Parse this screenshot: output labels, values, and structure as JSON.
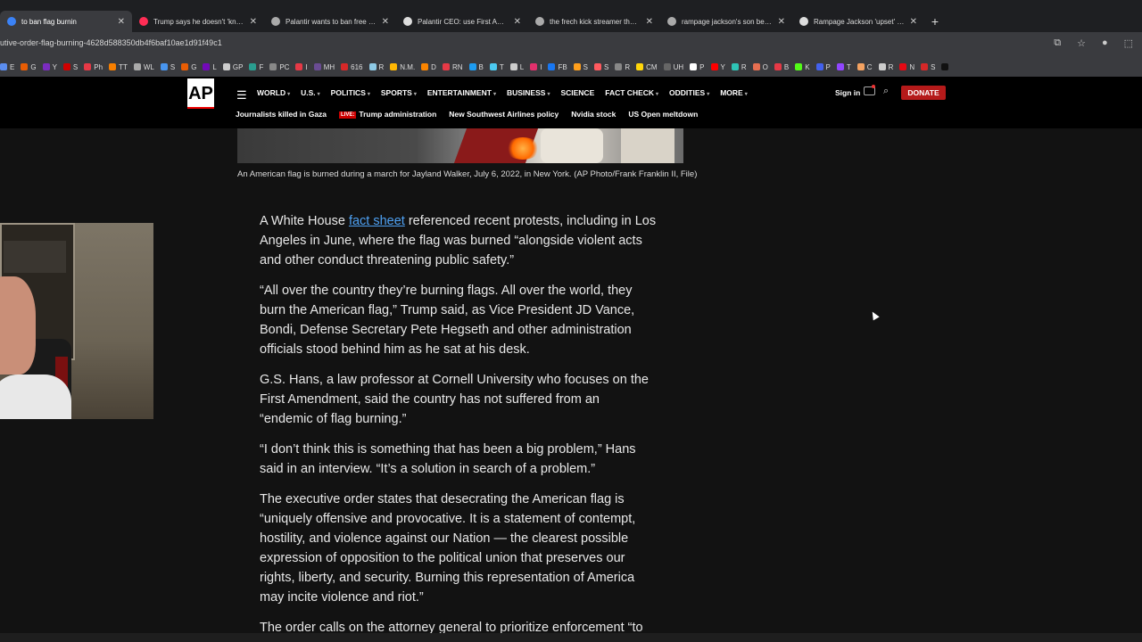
{
  "browser": {
    "tabs": [
      {
        "label": "to ban flag burnin",
        "active": true,
        "icon": "ap-icon",
        "color": "#3b82f6"
      },
      {
        "label": "Trump says he doesn't 'know' if",
        "active": false,
        "icon": "yahoo-icon",
        "color": "#ff2d55"
      },
      {
        "label": "Palantir wants to ban free speech",
        "active": false,
        "icon": "google-icon",
        "color": "#aaaaaa"
      },
      {
        "label": "Palantir CEO: use First Amendm",
        "active": false,
        "icon": "site-icon",
        "color": "#dddddd"
      },
      {
        "label": "the frech kick streamer that mu",
        "active": false,
        "icon": "google-icon",
        "color": "#aaaaaa"
      },
      {
        "label": "rampage jackson's son beat a u",
        "active": false,
        "icon": "google-icon",
        "color": "#aaaaaa"
      },
      {
        "label": "Rampage Jackson 'upset' after",
        "active": false,
        "icon": "site-icon",
        "color": "#dddddd"
      }
    ],
    "new_tab": "+",
    "url": "utive-order-flag-burning-4628d588350db4f6baf10ae1d91f49c1",
    "bookmarks": [
      {
        "label": "E",
        "color": "#5b8def"
      },
      {
        "label": "G",
        "color": "#e85d04"
      },
      {
        "label": "Y",
        "color": "#7b2cbf"
      },
      {
        "label": "S",
        "color": "#d00000"
      },
      {
        "label": "Ph",
        "color": "#e63946"
      },
      {
        "label": "TT",
        "color": "#f77f00"
      },
      {
        "label": "WL",
        "color": "#aaaaaa"
      },
      {
        "label": "S",
        "color": "#4895ef"
      },
      {
        "label": "G",
        "color": "#e85d04"
      },
      {
        "label": "L",
        "color": "#7209b7"
      },
      {
        "label": "GP",
        "color": "#cccccc"
      },
      {
        "label": "F",
        "color": "#2a9d8f"
      },
      {
        "label": "PC",
        "color": "#888888"
      },
      {
        "label": "I",
        "color": "#e63946"
      },
      {
        "label": "MH",
        "color": "#6a4c93"
      },
      {
        "label": "616",
        "color": "#d62828"
      },
      {
        "label": "R",
        "color": "#8ecae6"
      },
      {
        "label": "N.M.",
        "color": "#ffb703"
      },
      {
        "label": "D",
        "color": "#fb8500"
      },
      {
        "label": "RN",
        "color": "#e63946"
      },
      {
        "label": "B",
        "color": "#1d9bf0"
      },
      {
        "label": "T",
        "color": "#4cc9f0"
      },
      {
        "label": "L",
        "color": "#cccccc"
      },
      {
        "label": "I",
        "color": "#e1306c"
      },
      {
        "label": "FB",
        "color": "#1877f2"
      },
      {
        "label": "S",
        "color": "#ff9f1c"
      },
      {
        "label": "S",
        "color": "#ff5a5f"
      },
      {
        "label": "R",
        "color": "#888888"
      },
      {
        "label": "CM",
        "color": "#ffd60a"
      },
      {
        "label": "UH",
        "color": "#666666"
      },
      {
        "label": "P",
        "color": "#ffffff"
      },
      {
        "label": "Y",
        "color": "#ff0000"
      },
      {
        "label": "R",
        "color": "#2ec4b6"
      },
      {
        "label": "O",
        "color": "#e76f51"
      },
      {
        "label": "B",
        "color": "#e63946"
      },
      {
        "label": "K",
        "color": "#53fc18"
      },
      {
        "label": "P",
        "color": "#4361ee"
      },
      {
        "label": "T",
        "color": "#9146ff"
      },
      {
        "label": "C",
        "color": "#f4a261"
      },
      {
        "label": "R",
        "color": "#cccccc"
      },
      {
        "label": "N",
        "color": "#e50914"
      },
      {
        "label": "S",
        "color": "#d62828"
      },
      {
        "label": "",
        "color": "#111111"
      }
    ]
  },
  "ap": {
    "logo": "AP",
    "nav": [
      {
        "label": "WORLD",
        "caret": true
      },
      {
        "label": "U.S.",
        "caret": true
      },
      {
        "label": "POLITICS",
        "caret": true
      },
      {
        "label": "SPORTS",
        "caret": true
      },
      {
        "label": "ENTERTAINMENT",
        "caret": true
      },
      {
        "label": "BUSINESS",
        "caret": true
      },
      {
        "label": "SCIENCE",
        "caret": false
      },
      {
        "label": "FACT CHECK",
        "caret": true
      },
      {
        "label": "ODDITIES",
        "caret": true
      },
      {
        "label": "MORE",
        "caret": true
      }
    ],
    "signin": "Sign in",
    "donate": "DONATE",
    "live_badge": "LIVE:",
    "trending": [
      {
        "label": "Journalists killed in Gaza",
        "live": false
      },
      {
        "label": "Trump administration",
        "live": true
      },
      {
        "label": "New Southwest Airlines policy",
        "live": false
      },
      {
        "label": "Nvidia stock",
        "live": false
      },
      {
        "label": "US Open meltdown",
        "live": false
      }
    ]
  },
  "article": {
    "caption": "An American flag is burned during a march for Jayland Walker, July 6, 2022, in New York. (AP Photo/Frank Franklin II, File)",
    "p1_before": "A White House ",
    "p1_link": "fact sheet",
    "p1_after": " referenced recent protests, including in Los\nAngeles in June, where the flag was burned “alongside violent acts\nand other conduct threatening public safety.”",
    "p2": "“All over the country they’re burning flags. All over the world, they\nburn the American flag,” Trump said, as Vice President JD Vance,\nBondi, Defense Secretary Pete Hegseth and other administration\nofficials stood behind him as he sat at his desk.",
    "p3": "G.S. Hans, a law professor at Cornell University who focuses on the\nFirst Amendment, said the country has not suffered from an\n“endemic of flag burning.”",
    "p4": "“I don’t think this is something that has been a big problem,” Hans\nsaid in an interview. “It’s a solution in search of a problem.”",
    "p5": "The executive order states that desecrating the American flag is\n“uniquely offensive and provocative. It is a statement of contempt,\nhostility, and violence against our Nation — the clearest possible\nexpression of opposition to the political union that preserves our\nrights, liberty, and security. Burning this representation of America\nmay incite violence and riot.”",
    "p6": "The order calls on the attorney general to prioritize enforcement “to"
  }
}
